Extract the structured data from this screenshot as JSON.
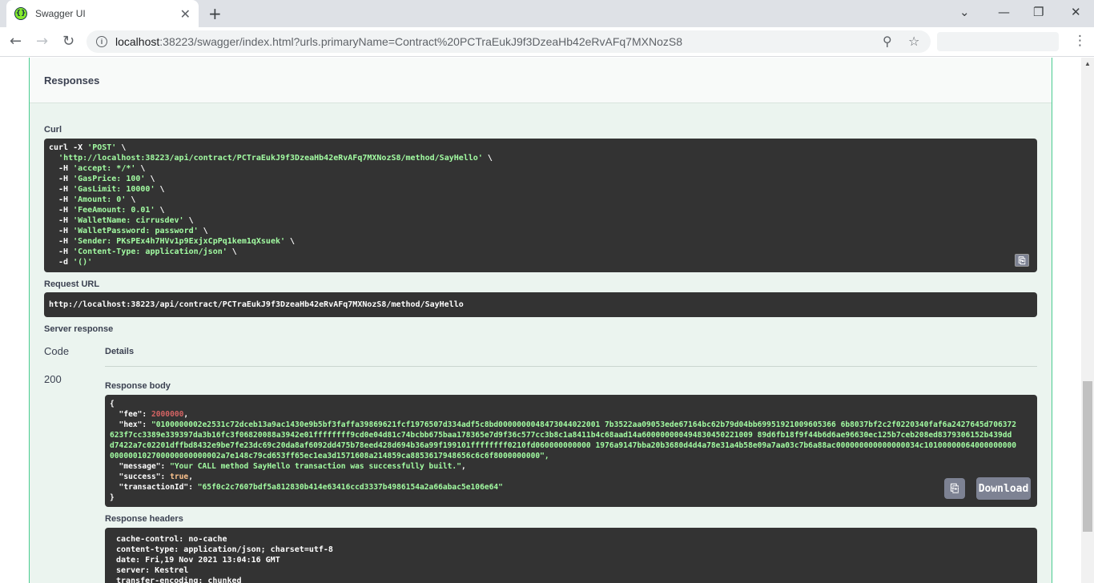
{
  "browser": {
    "tab_title": "Swagger UI",
    "url_host": "localhost",
    "url_rest": ":38223/swagger/index.html?urls.primaryName=Contract%20PCTraEukJ9f3DzeaHb42eRvAFq7MXNozS8"
  },
  "responses": {
    "heading": "Responses",
    "curl_label": "Curl",
    "curl_lines": [
      "curl -X 'POST' \\",
      "  'http://localhost:38223/api/contract/PCTraEukJ9f3DzeaHb42eRvAFq7MXNozS8/method/SayHello' \\",
      "  -H 'accept: */*' \\",
      "  -H 'GasPrice: 100' \\",
      "  -H 'GasLimit: 10000' \\",
      "  -H 'Amount: 0' \\",
      "  -H 'FeeAmount: 0.01' \\",
      "  -H 'WalletName: cirrusdev' \\",
      "  -H 'WalletPassword: password' \\",
      "  -H 'Sender: PKsPEx4h7HVv1p9ExjxCpPq1kem1qXsuek' \\",
      "  -H 'Content-Type: application/json' \\",
      "  -d '()'"
    ],
    "request_url_label": "Request URL",
    "request_url": "http://localhost:38223/api/contract/PCTraEukJ9f3DzeaHb42eRvAFq7MXNozS8/method/SayHello",
    "server_response_label": "Server response",
    "code_header": "Code",
    "details_header": "Details",
    "status_code": "200",
    "response_body_label": "Response body",
    "body": {
      "open": "{",
      "fee_key": "  \"fee\": ",
      "fee_value": "2000000",
      "hex_key": "  \"hex\": ",
      "hex_lines": [
        "\"0100000002e2531c72dceb13a9ac1430e9b5bf3faffa39869621fcf1976507d334adf5c8bd0000000048473044022001 7b3522aa09053ede67164bc62b79d04bb69951921009605366 6b8037bf2c2f0220340faf6a2427645d706372",
        "623f7cc3389e339397da3b16fc3f06820088a3942e01ffffffff9cd0e04d81c74bcbb675baa178365e7d9f36c577cc3b8c1a8411b4c68aad14a600000000494830450221009 89d6fb18f9f44b6d6ae96630ec125b7ceb208ed8379306152b439dd",
        "d7422a7c02201dffbd8432e9be7fe23dc69c20da8af6092dd475b78eed428d694b36a99f199101ffffffff0210fd060000000000 1976a9147bba20b3680d4d4a78e31a4b58e09a7aa03c7b6a88ac000000000000000034c10100000064000000000",
        "000000102700000000000002a7e148c79cd653ff65ec1ea3d1571608a214859ca8853617948656c6c6f8000000000\","
      ],
      "message_key": "  \"message\": ",
      "message_value": "\"Your CALL method SayHello transaction was successfully built.\"",
      "success_key": "  \"success\": ",
      "success_value": "true",
      "txid_key": "  \"transactionId\": ",
      "txid_value": "\"65f0c2c7607bdf5a812830b414e63416ccd3337b4986154a2a66abac5e106e64\"",
      "close": "}"
    },
    "download_label": "Download",
    "response_headers_label": "Response headers",
    "headers": [
      " cache-control: no-cache",
      " content-type: application/json; charset=utf-8",
      " date: Fri,19 Nov 2021 13:04:16 GMT",
      " server: Kestrel",
      " transfer-encoding: chunked"
    ]
  }
}
